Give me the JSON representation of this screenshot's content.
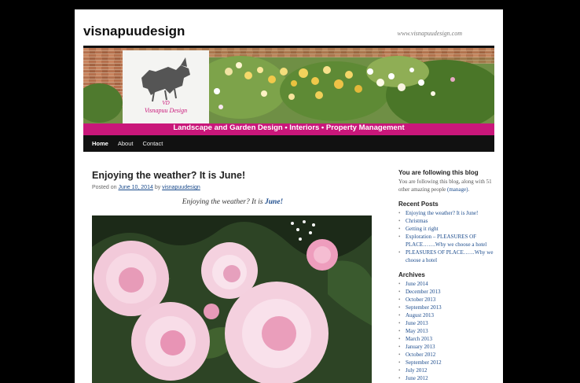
{
  "site": {
    "title": "visnapuudesign",
    "description": "www.visnapuudesign.com"
  },
  "banner": {
    "logo_text": "Visnapuu Design",
    "logo_monogram": "VD",
    "tagline": "Landscape and Garden Design • Interiors • Property Management",
    "colors": {
      "tagline_bar": "#c9177a"
    }
  },
  "nav": {
    "items": [
      {
        "label": "Home",
        "current": true
      },
      {
        "label": "About",
        "current": false
      },
      {
        "label": "Contact",
        "current": false
      }
    ]
  },
  "post": {
    "title": "Enjoying the weather? It is June!",
    "meta_prefix": "Posted on",
    "date": "June 10, 2014",
    "meta_by": "by",
    "author": "visnapuudesign",
    "intro_text": "Enjoying the weather? It is",
    "intro_link": "June!"
  },
  "sidebar": {
    "follow": {
      "title": "You are following this blog",
      "text": "You are following this blog, along with 51 other amazing people",
      "link": "(manage)",
      "end": "."
    },
    "recent": {
      "title": "Recent Posts",
      "items": [
        "Enjoying the weather? It is June!",
        "Christmas",
        "Getting it right",
        "Exploration – PLEASURES OF PLACE…….Why we choose a hotel",
        "PLEASURES OF PLACE……Why we choose a hotel"
      ]
    },
    "archives": {
      "title": "Archives",
      "items": [
        "June 2014",
        "December 2013",
        "October 2013",
        "September 2013",
        "August 2013",
        "June 2013",
        "May 2013",
        "March 2013",
        "January 2013",
        "October 2012",
        "September 2012",
        "July 2012",
        "June 2012"
      ]
    }
  }
}
